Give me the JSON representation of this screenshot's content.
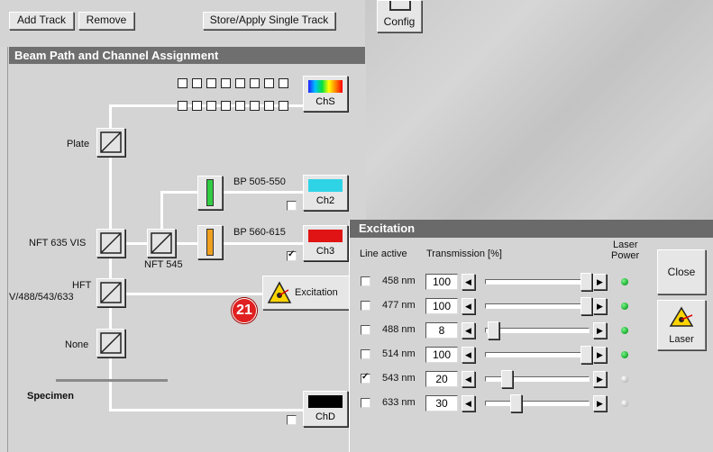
{
  "toolbar": {
    "add_track": "Add Track",
    "remove": "Remove",
    "store_apply": "Store/Apply Single Track",
    "config": "Config"
  },
  "beam_panel": {
    "title": "Beam Path and Channel Assignment",
    "plate": "Plate",
    "nft635": "NFT 635 VIS",
    "nft545": "NFT 545",
    "hft_line1": "HFT",
    "hft_line2": "V/488/543/633",
    "none": "None",
    "specimen": "Specimen",
    "bp1": "BP 505-550",
    "bp2": "BP 560-615",
    "excitation_btn": "Excitation",
    "callout": "21",
    "channels": [
      {
        "name": "ChS",
        "checked": false
      },
      {
        "name": "Ch2",
        "checked": false
      },
      {
        "name": "Ch3",
        "checked": true
      },
      {
        "name": "ChD",
        "checked": false
      }
    ]
  },
  "colors": {
    "ch2": "#2fd3e6",
    "ch3": "#e01414",
    "chd": "#000000",
    "bp1_filter": "#33cc44",
    "bp2_filter": "#f0a020",
    "led_on": "#22b83a",
    "led_off": "#c8c8c8",
    "callout": "#e02020"
  },
  "excitation": {
    "title": "Excitation",
    "col_line_active": "Line active",
    "col_transmission": "Transmission [%]",
    "col_laser_power_1": "Laser",
    "col_laser_power_2": "Power",
    "close": "Close",
    "laser": "Laser",
    "lines": [
      {
        "wavelength": "458 nm",
        "active": false,
        "transmission": "100",
        "power_on": true
      },
      {
        "wavelength": "477 nm",
        "active": false,
        "transmission": "100",
        "power_on": true
      },
      {
        "wavelength": "488 nm",
        "active": false,
        "transmission": "8",
        "power_on": true
      },
      {
        "wavelength": "514 nm",
        "active": false,
        "transmission": "100",
        "power_on": true
      },
      {
        "wavelength": "543 nm",
        "active": true,
        "transmission": "20",
        "power_on": false
      },
      {
        "wavelength": "633 nm",
        "active": false,
        "transmission": "30",
        "power_on": false
      }
    ]
  }
}
